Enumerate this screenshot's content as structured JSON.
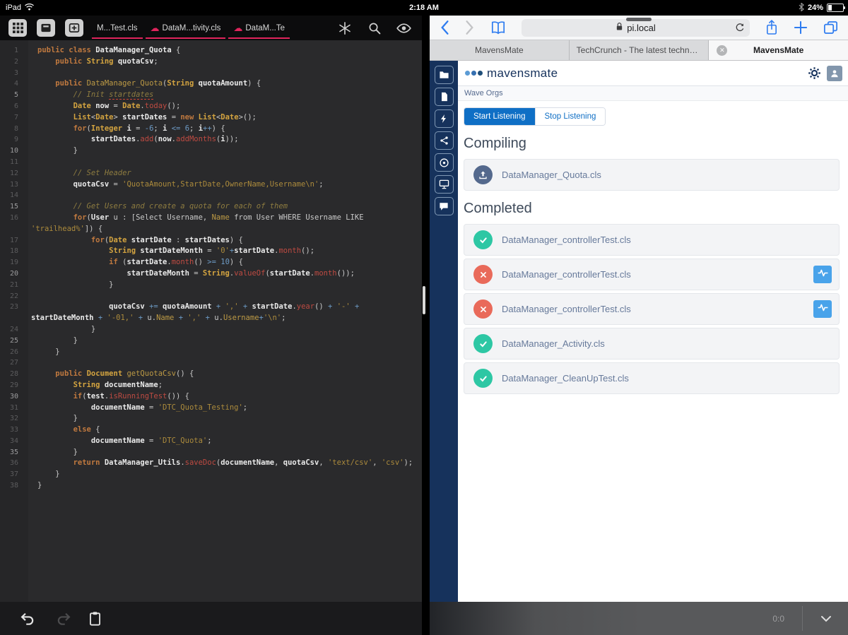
{
  "status_bar": {
    "device": "iPad",
    "time": "2:18 AM",
    "battery": "24%",
    "icons": [
      "wifi",
      "bluetooth",
      "battery"
    ]
  },
  "editor": {
    "toolbar_left_icons": [
      "app-grid",
      "close-panel",
      "add-tab"
    ],
    "toolbar_right_icons": [
      "symbols-star",
      "search",
      "preview-eye",
      "done-check"
    ],
    "tabs": [
      {
        "label": "M...Test.cls",
        "cloud": false
      },
      {
        "label": "DataM...tivity.cls",
        "cloud": true
      },
      {
        "label": "DataM...Te",
        "cloud": true
      }
    ],
    "colors": {
      "background": "#2a2a2c",
      "tab_underline": "#e0245c",
      "cloud_icon": "#e0245c"
    },
    "rows": [
      {
        "n": "1",
        "seg": [
          [
            "public class ",
            "k"
          ],
          [
            "DataManager_Quota",
            "d"
          ],
          [
            " {",
            "p"
          ]
        ]
      },
      {
        "n": "2",
        "seg": [
          [
            "    ",
            "p"
          ],
          [
            "public ",
            "k"
          ],
          [
            "String ",
            "t"
          ],
          [
            "quotaCsv",
            "d"
          ],
          [
            ";",
            "p"
          ]
        ]
      },
      {
        "n": "3",
        "seg": []
      },
      {
        "n": "4",
        "seg": [
          [
            "    ",
            "p"
          ],
          [
            "public ",
            "k"
          ],
          [
            "DataManager_Quota",
            "f"
          ],
          [
            "(",
            "p"
          ],
          [
            "String ",
            "t"
          ],
          [
            "quotaAmount",
            "d"
          ],
          [
            ") {",
            "p"
          ]
        ]
      },
      {
        "n": "5",
        "seg": [
          [
            "        ",
            "p"
          ],
          [
            "// Init ",
            "c"
          ],
          [
            "startdates",
            "cu"
          ]
        ]
      },
      {
        "n": "6",
        "seg": [
          [
            "        ",
            "p"
          ],
          [
            "Date ",
            "t"
          ],
          [
            "now",
            "d"
          ],
          [
            " = ",
            "p"
          ],
          [
            "Date",
            "t"
          ],
          [
            ".",
            "p"
          ],
          [
            "today",
            "m"
          ],
          [
            "();",
            "p"
          ]
        ]
      },
      {
        "n": "7",
        "seg": [
          [
            "        ",
            "p"
          ],
          [
            "List",
            "t"
          ],
          [
            "<",
            "p"
          ],
          [
            "Date",
            "t"
          ],
          [
            "> ",
            "p"
          ],
          [
            "startDates",
            "d"
          ],
          [
            " = ",
            "p"
          ],
          [
            "new ",
            "k"
          ],
          [
            "List",
            "t"
          ],
          [
            "<",
            "p"
          ],
          [
            "Date",
            "t"
          ],
          [
            ">();",
            "p"
          ]
        ]
      },
      {
        "n": "8",
        "seg": [
          [
            "        ",
            "p"
          ],
          [
            "for",
            "k"
          ],
          [
            "(",
            "p"
          ],
          [
            "Integer ",
            "t"
          ],
          [
            "i",
            "d"
          ],
          [
            " = ",
            "p"
          ],
          [
            "-6",
            "n"
          ],
          [
            "; ",
            "p"
          ],
          [
            "i",
            "d"
          ],
          [
            " ",
            "p"
          ],
          [
            "<=",
            "n"
          ],
          [
            " ",
            "p"
          ],
          [
            "6",
            "n"
          ],
          [
            "; ",
            "p"
          ],
          [
            "i",
            "d"
          ],
          [
            "++",
            "n"
          ],
          [
            ") {",
            "p"
          ]
        ]
      },
      {
        "n": "9",
        "seg": [
          [
            "            ",
            "p"
          ],
          [
            "startDates",
            "d"
          ],
          [
            ".",
            "p"
          ],
          [
            "add",
            "m"
          ],
          [
            "(",
            "p"
          ],
          [
            "now",
            "d"
          ],
          [
            ".",
            "p"
          ],
          [
            "addMonths",
            "m"
          ],
          [
            "(",
            "p"
          ],
          [
            "i",
            "d"
          ],
          [
            "));",
            "p"
          ]
        ]
      },
      {
        "n": "10",
        "seg": [
          [
            "        }",
            "p"
          ]
        ]
      },
      {
        "n": "11",
        "seg": []
      },
      {
        "n": "12",
        "seg": [
          [
            "        ",
            "p"
          ],
          [
            "// Set Header",
            "c"
          ]
        ]
      },
      {
        "n": "13",
        "seg": [
          [
            "        ",
            "p"
          ],
          [
            "quotaCsv",
            "d"
          ],
          [
            " = ",
            "p"
          ],
          [
            "'QuotaAmount,StartDate,OwnerName,Username\\n'",
            "s"
          ],
          [
            ";",
            "p"
          ]
        ]
      },
      {
        "n": "14",
        "seg": []
      },
      {
        "n": "15",
        "seg": [
          [
            "        ",
            "p"
          ],
          [
            "// Get Users and create a quota for each of them",
            "c"
          ]
        ]
      },
      {
        "n": "16",
        "seg": [
          [
            "        ",
            "p"
          ],
          [
            "for",
            "k"
          ],
          [
            "(",
            "p"
          ],
          [
            "User",
            "d"
          ],
          [
            " u : [Select Username, ",
            "p"
          ],
          [
            "Name",
            "f"
          ],
          [
            " from User WHERE Username LIKE",
            "p"
          ]
        ]
      },
      {
        "n": "",
        "seg": [
          [
            "'trailhead%'",
            "s"
          ],
          [
            "]) {",
            "p"
          ]
        ]
      },
      {
        "n": "17",
        "seg": [
          [
            "            ",
            "p"
          ],
          [
            "for",
            "k"
          ],
          [
            "(",
            "p"
          ],
          [
            "Date ",
            "t"
          ],
          [
            "startDate",
            "d"
          ],
          [
            " : ",
            "p"
          ],
          [
            "startDates",
            "d"
          ],
          [
            ") {",
            "p"
          ]
        ]
      },
      {
        "n": "18",
        "seg": [
          [
            "                ",
            "p"
          ],
          [
            "String ",
            "t"
          ],
          [
            "startDateMonth",
            "d"
          ],
          [
            " = ",
            "p"
          ],
          [
            "'0'",
            "s"
          ],
          [
            "+",
            "n"
          ],
          [
            "startDate",
            "d"
          ],
          [
            ".",
            "p"
          ],
          [
            "month",
            "m"
          ],
          [
            "();",
            "p"
          ]
        ]
      },
      {
        "n": "19",
        "seg": [
          [
            "                ",
            "p"
          ],
          [
            "if",
            "k"
          ],
          [
            " (",
            "p"
          ],
          [
            "startDate",
            "d"
          ],
          [
            ".",
            "p"
          ],
          [
            "month",
            "m"
          ],
          [
            "() ",
            "p"
          ],
          [
            ">=",
            "n"
          ],
          [
            " ",
            "p"
          ],
          [
            "10",
            "n"
          ],
          [
            ") {",
            "p"
          ]
        ]
      },
      {
        "n": "20",
        "seg": [
          [
            "                    ",
            "p"
          ],
          [
            "startDateMonth",
            "d"
          ],
          [
            " = ",
            "p"
          ],
          [
            "String",
            "t"
          ],
          [
            ".",
            "p"
          ],
          [
            "valueOf",
            "m"
          ],
          [
            "(",
            "p"
          ],
          [
            "startDate",
            "d"
          ],
          [
            ".",
            "p"
          ],
          [
            "month",
            "m"
          ],
          [
            "());",
            "p"
          ]
        ]
      },
      {
        "n": "21",
        "seg": [
          [
            "                }",
            "p"
          ]
        ]
      },
      {
        "n": "22",
        "seg": []
      },
      {
        "n": "23",
        "seg": [
          [
            "                ",
            "p"
          ],
          [
            "quotaCsv",
            "d"
          ],
          [
            " ",
            "p"
          ],
          [
            "+=",
            "n"
          ],
          [
            " ",
            "p"
          ],
          [
            "quotaAmount",
            "d"
          ],
          [
            " ",
            "p"
          ],
          [
            "+",
            "n"
          ],
          [
            " ",
            "p"
          ],
          [
            "','",
            "s"
          ],
          [
            " ",
            "p"
          ],
          [
            "+",
            "n"
          ],
          [
            " ",
            "p"
          ],
          [
            "startDate",
            "d"
          ],
          [
            ".",
            "p"
          ],
          [
            "year",
            "m"
          ],
          [
            "() ",
            "p"
          ],
          [
            "+",
            "n"
          ],
          [
            " ",
            "p"
          ],
          [
            "'-'",
            "s"
          ],
          [
            " ",
            "p"
          ],
          [
            "+",
            "n"
          ]
        ]
      },
      {
        "n": "",
        "seg": [
          [
            "startDateMonth",
            "d"
          ],
          [
            " ",
            "p"
          ],
          [
            "+",
            "n"
          ],
          [
            " ",
            "p"
          ],
          [
            "'-01,'",
            "s"
          ],
          [
            " ",
            "p"
          ],
          [
            "+",
            "n"
          ],
          [
            " u.",
            "p"
          ],
          [
            "Name",
            "f"
          ],
          [
            " ",
            "p"
          ],
          [
            "+",
            "n"
          ],
          [
            " ",
            "p"
          ],
          [
            "','",
            "s"
          ],
          [
            " ",
            "p"
          ],
          [
            "+",
            "n"
          ],
          [
            " u.",
            "p"
          ],
          [
            "Username",
            "f"
          ],
          [
            "+",
            "n"
          ],
          [
            "'\\n'",
            "s"
          ],
          [
            ";",
            "p"
          ]
        ]
      },
      {
        "n": "24",
        "seg": [
          [
            "            }",
            "p"
          ]
        ]
      },
      {
        "n": "25",
        "seg": [
          [
            "        }",
            "p"
          ]
        ]
      },
      {
        "n": "26",
        "seg": [
          [
            "    }",
            "p"
          ]
        ]
      },
      {
        "n": "27",
        "seg": []
      },
      {
        "n": "28",
        "seg": [
          [
            "    ",
            "p"
          ],
          [
            "public ",
            "k"
          ],
          [
            "Document ",
            "t"
          ],
          [
            "getQuotaCsv",
            "f"
          ],
          [
            "() {",
            "p"
          ]
        ]
      },
      {
        "n": "29",
        "seg": [
          [
            "        ",
            "p"
          ],
          [
            "String ",
            "t"
          ],
          [
            "documentName",
            "d"
          ],
          [
            ";",
            "p"
          ]
        ]
      },
      {
        "n": "30",
        "seg": [
          [
            "        ",
            "p"
          ],
          [
            "if",
            "k"
          ],
          [
            "(",
            "p"
          ],
          [
            "test",
            "d"
          ],
          [
            ".",
            "p"
          ],
          [
            "isRunningTest",
            "m"
          ],
          [
            "()) {",
            "p"
          ]
        ]
      },
      {
        "n": "31",
        "seg": [
          [
            "            ",
            "p"
          ],
          [
            "documentName",
            "d"
          ],
          [
            " = ",
            "p"
          ],
          [
            "'DTC_Quota_Testing'",
            "s"
          ],
          [
            ";",
            "p"
          ]
        ]
      },
      {
        "n": "32",
        "seg": [
          [
            "        }",
            "p"
          ]
        ]
      },
      {
        "n": "33",
        "seg": [
          [
            "        ",
            "p"
          ],
          [
            "else",
            "k"
          ],
          [
            " {",
            "p"
          ]
        ]
      },
      {
        "n": "34",
        "seg": [
          [
            "            ",
            "p"
          ],
          [
            "documentName",
            "d"
          ],
          [
            " = ",
            "p"
          ],
          [
            "'DTC_Quota'",
            "s"
          ],
          [
            ";",
            "p"
          ]
        ]
      },
      {
        "n": "35",
        "seg": [
          [
            "        }",
            "p"
          ]
        ]
      },
      {
        "n": "36",
        "seg": [
          [
            "        ",
            "p"
          ],
          [
            "return ",
            "k"
          ],
          [
            "DataManager_Utils",
            "d"
          ],
          [
            ".",
            "p"
          ],
          [
            "saveDoc",
            "m"
          ],
          [
            "(",
            "p"
          ],
          [
            "documentName",
            "d"
          ],
          [
            ", ",
            "p"
          ],
          [
            "quotaCsv",
            "d"
          ],
          [
            ", ",
            "p"
          ],
          [
            "'text/csv'",
            "s"
          ],
          [
            ", ",
            "p"
          ],
          [
            "'csv'",
            "s"
          ],
          [
            ");",
            "p"
          ]
        ]
      },
      {
        "n": "37",
        "seg": [
          [
            "    }",
            "p"
          ]
        ]
      },
      {
        "n": "38",
        "seg": [
          [
            "}",
            "p"
          ]
        ]
      }
    ]
  },
  "accessory_bar": {
    "icons": [
      {
        "name": "undo",
        "enabled": true
      },
      {
        "name": "redo",
        "enabled": false
      },
      {
        "name": "clipboard",
        "enabled": true
      }
    ]
  },
  "safari": {
    "url": "pi.local",
    "toolbar_icons": [
      "back",
      "forward",
      "bookmarks",
      "lock",
      "reload",
      "share",
      "new-tab",
      "tabs"
    ],
    "tabs": [
      {
        "title": "MavensMate",
        "active": false,
        "closable": false
      },
      {
        "title": "TechCrunch - The latest technol...",
        "active": false,
        "closable": false
      },
      {
        "title": "MavensMate",
        "active": true,
        "closable": true
      }
    ]
  },
  "mavensmate": {
    "logo_text": "mavensmate",
    "logo_dot_colors": [
      "#5b9bd5",
      "#3670b0",
      "#1f4e79"
    ],
    "header_icons": [
      "gear",
      "user"
    ],
    "breadcrumb": "Wave Orgs",
    "buttons": {
      "start": "Start Listening",
      "stop": "Stop Listening"
    },
    "sidebar_icons": [
      "folder",
      "file",
      "lightning",
      "share-network",
      "disc",
      "monitor",
      "chat"
    ],
    "colors": {
      "navy": "#16325c",
      "brand_blue": "#0f6fc5",
      "success_green": "#2dc7a4",
      "error_red": "#e96a5a",
      "action_blue": "#49a3ea",
      "uploading_slate": "#54698d"
    },
    "sections": [
      {
        "title": "Compiling",
        "items": [
          {
            "file": "DataManager_Quota.cls",
            "status": "uploading",
            "action": false
          }
        ]
      },
      {
        "title": "Completed",
        "items": [
          {
            "file": "DataManager_controllerTest.cls",
            "status": "success",
            "action": false
          },
          {
            "file": "DataManager_controllerTest.cls",
            "status": "error",
            "action": true
          },
          {
            "file": "DataManager_controllerTest.cls",
            "status": "error",
            "action": true
          },
          {
            "file": "DataManager_Activity.cls",
            "status": "success",
            "action": false
          },
          {
            "file": "DataManager_CleanUpTest.cls",
            "status": "success",
            "action": false
          }
        ]
      }
    ]
  },
  "bottom_bar": {
    "position": "0:0"
  }
}
